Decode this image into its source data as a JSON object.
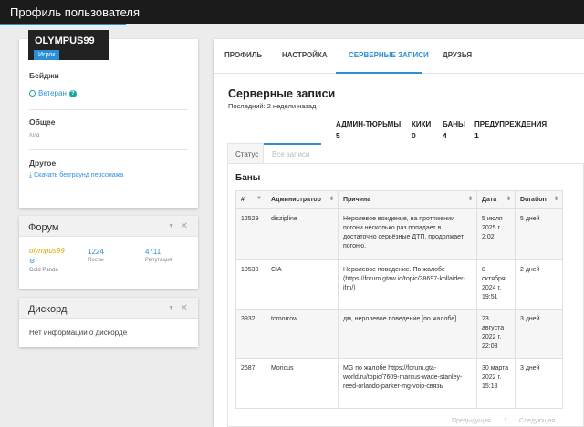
{
  "header": {
    "title": "Профиль пользователя"
  },
  "profile": {
    "username": "OLYMPUS99",
    "role": "Игрок",
    "badges_title": "Бейджи",
    "badge": "Ветеран",
    "general_title": "Общее",
    "general_value": "N/A",
    "other_title": "Другое",
    "download_link": "Скачать бекграунд персонажа"
  },
  "forum": {
    "title": "Форум",
    "username": "olympus99",
    "group": "Gold Panda",
    "posts_value": "1224",
    "posts_label": "Посты",
    "rep_value": "4711",
    "rep_label": "Репутация"
  },
  "discord": {
    "title": "Дискорд",
    "text": "Нет информации о дискорде"
  },
  "main": {
    "tabs": [
      "ПРОФИЛЬ",
      "НАСТРОЙКА",
      "СЕРВЕРНЫЕ ЗАПИСИ",
      "ДРУЗЬЯ"
    ],
    "active_tab": "СЕРВЕРНЫЕ ЗАПИСИ",
    "title": "Серверные записи",
    "last_seen": "Последний: 2 недели назад",
    "stats": [
      {
        "label": "АДМИН-ТЮРЬМЫ",
        "value": "5"
      },
      {
        "label": "КИКИ",
        "value": "0"
      },
      {
        "label": "БАНЫ",
        "value": "4"
      },
      {
        "label": "ПРЕДУПРЕЖДЕНИЯ",
        "value": "1"
      }
    ],
    "subtabs": [
      "Статус",
      "Все записи"
    ],
    "bans_title": "Баны",
    "columns": [
      "#",
      "Администратор",
      "Причина",
      "Дата",
      "Duration"
    ],
    "rows": [
      {
        "id": "12529",
        "admin": "diszipline",
        "reason": "Неролевое вождение, на протяжении погони несколько раз попадает в достаточно серьёзные ДТП, продолжает погоню.",
        "date": "5 июля 2025 г. 2:02",
        "duration": "5 дней"
      },
      {
        "id": "10530",
        "admin": "CIA",
        "reason": "Неролевое поведение. По жалобе (https://forum.gtaw.io/topic/38697-kollaider-ifm/)",
        "date": "8 октября 2024 г. 19:51",
        "duration": "2 дней"
      },
      {
        "id": "3932",
        "admin": "tomorrow",
        "reason": "дм, неролевое поведение [по жалобе]",
        "date": "23 августа 2022 г. 22:03",
        "duration": "3 дней"
      },
      {
        "id": "2687",
        "admin": "Moricus",
        "reason": "MG по жалобе https://forum.gta-world.ru/topic/7609-marcus-wade-stanley-reed-orlando-parker-mg-voip-связь",
        "date": "30 марта 2022 г. 15:18",
        "duration": "3 дней"
      }
    ],
    "pager": {
      "prev": "Предыдущая",
      "page": "1",
      "next": "Следующая"
    }
  },
  "colors": {
    "accent": "#2a8fd6",
    "topbar": "#1b1b1b",
    "forum_user": "#e2a400"
  },
  "icons": [
    "badge-icon",
    "help-icon",
    "download-icon",
    "gear-icon",
    "chevron-down-icon",
    "close-icon",
    "sort-icon"
  ]
}
